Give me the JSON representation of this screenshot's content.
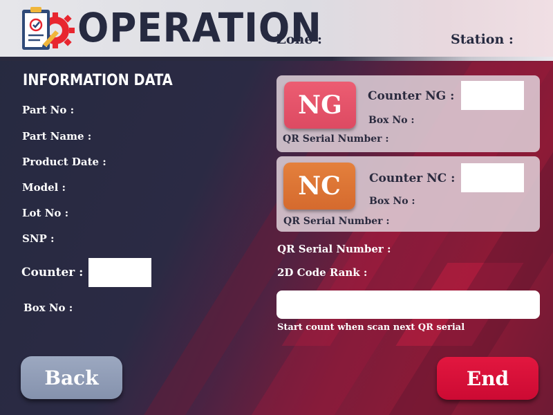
{
  "header": {
    "title": "OPERATION",
    "zone_label": "Zone :",
    "station_label": "Station :"
  },
  "info": {
    "title": "INFORMATION DATA",
    "fields": [
      "Part No :",
      "Part Name :",
      "Product Date :",
      "Model :",
      "Lot No :",
      "SNP :"
    ],
    "counter_label": "Counter :",
    "box_no_label": "Box No :"
  },
  "ng": {
    "badge": "NG",
    "counter_label": "Counter NG :",
    "box_no_label": "Box No :",
    "qr_label": "QR Serial Number :"
  },
  "nc": {
    "badge": "NC",
    "counter_label": "Counter NC :",
    "box_no_label": "Box No :",
    "qr_label": "QR Serial Number :"
  },
  "scan": {
    "qr_label": "QR Serial Number :",
    "rank_label": "2D Code Rank :",
    "input_value": "",
    "hint": "Start count when scan next QR serial"
  },
  "buttons": {
    "back": "Back",
    "end": "End"
  },
  "colors": {
    "ng": "#e55468",
    "nc": "#de763a",
    "end": "#d81039",
    "back": "#8e9ab4",
    "navy": "#262a40"
  },
  "icons": {
    "logo": "clipboard-gear-icon"
  }
}
